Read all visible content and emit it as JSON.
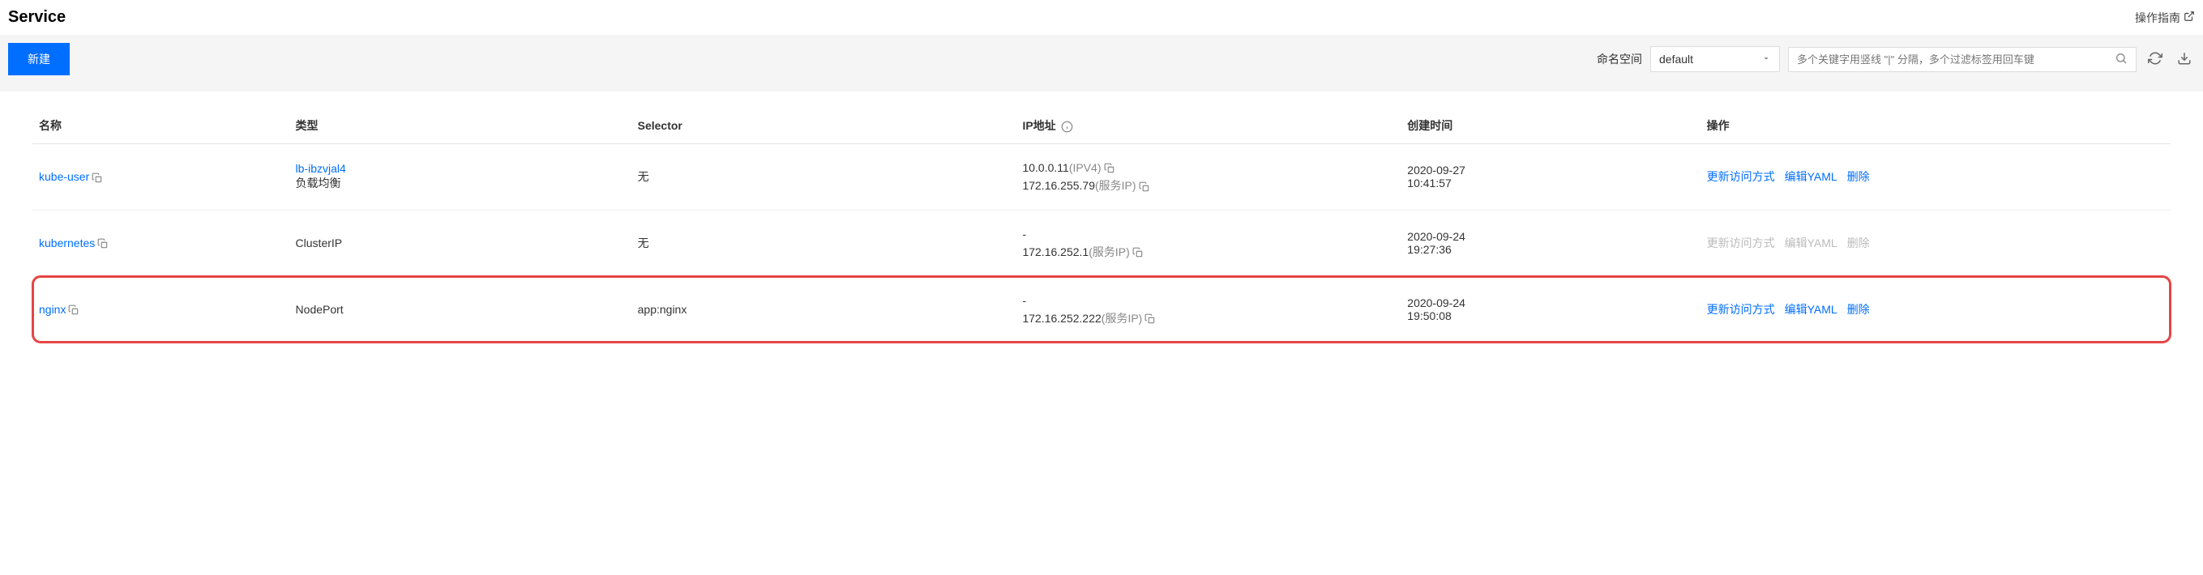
{
  "header": {
    "title": "Service",
    "guide_label": "操作指南"
  },
  "toolbar": {
    "create_label": "新建",
    "namespace_label": "命名空间",
    "namespace_value": "default",
    "search_placeholder": "多个关键字用竖线 \"|\" 分隔，多个过滤标签用回车键"
  },
  "table": {
    "headers": {
      "name": "名称",
      "type": "类型",
      "selector": "Selector",
      "ip": "IP地址",
      "created": "创建时间",
      "actions": "操作"
    },
    "action_labels": {
      "update_access": "更新访问方式",
      "edit_yaml": "编辑YAML",
      "delete": "删除"
    },
    "rows": [
      {
        "name": "kube-user",
        "type_link": "lb-ibzvjal4",
        "type_text": "负载均衡",
        "selector": "无",
        "ip1": "10.0.0.11",
        "ip1_suffix": "(IPV4)",
        "ip2": "172.16.255.79",
        "ip2_suffix": "(服务IP)",
        "created_date": "2020-09-27",
        "created_time": "10:41:57",
        "actions_enabled": true,
        "highlight": false
      },
      {
        "name": "kubernetes",
        "type_link": "",
        "type_text": "ClusterIP",
        "selector": "无",
        "ip1": "-",
        "ip1_suffix": "",
        "ip2": "172.16.252.1",
        "ip2_suffix": "(服务IP)",
        "created_date": "2020-09-24",
        "created_time": "19:27:36",
        "actions_enabled": false,
        "highlight": false
      },
      {
        "name": "nginx",
        "type_link": "",
        "type_text": "NodePort",
        "selector": "app:nginx",
        "ip1": "-",
        "ip1_suffix": "",
        "ip2": "172.16.252.222",
        "ip2_suffix": "(服务IP)",
        "created_date": "2020-09-24",
        "created_time": "19:50:08",
        "actions_enabled": true,
        "highlight": true
      }
    ]
  }
}
